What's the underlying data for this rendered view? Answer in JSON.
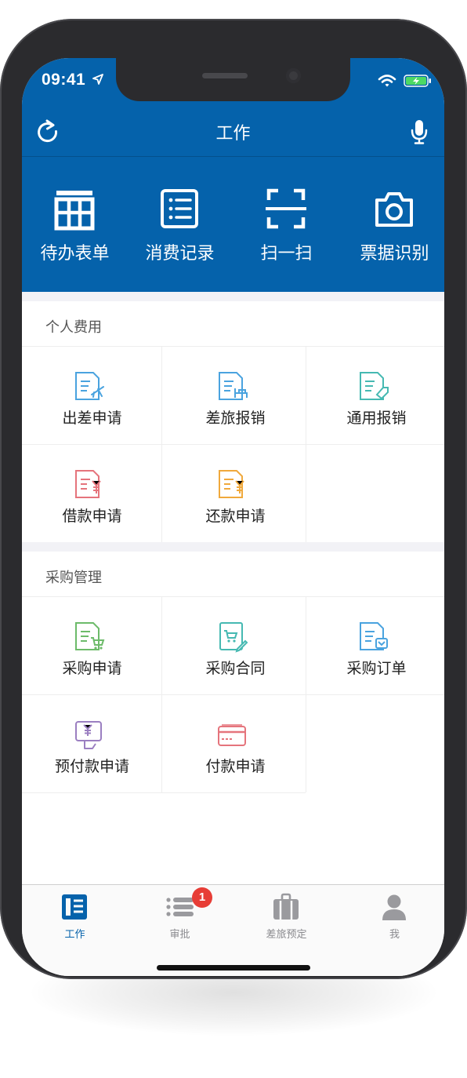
{
  "status_bar": {
    "time": "09:41"
  },
  "navbar": {
    "title": "工作"
  },
  "quick_actions": [
    {
      "label": "待办表单",
      "icon": "form-table-icon"
    },
    {
      "label": "消费记录",
      "icon": "list-record-icon"
    },
    {
      "label": "扫一扫",
      "icon": "scan-icon"
    },
    {
      "label": "票据识别",
      "icon": "camera-icon"
    }
  ],
  "personal": {
    "title": "个人费用",
    "items": [
      {
        "label": "出差申请",
        "icon": "doc-plane-icon",
        "color": "#4aa3df"
      },
      {
        "label": "差旅报销",
        "icon": "doc-bed-icon",
        "color": "#4aa3df"
      },
      {
        "label": "通用报销",
        "icon": "doc-tag-icon",
        "color": "#46b9b2"
      },
      {
        "label": "借款申请",
        "icon": "doc-yen-icon",
        "color": "#e5747c"
      },
      {
        "label": "还款申请",
        "icon": "doc-yen-return-icon",
        "color": "#f0a93c"
      }
    ]
  },
  "purchase": {
    "title": "采购管理",
    "items": [
      {
        "label": "采购申请",
        "icon": "doc-cart-icon",
        "color": "#6dbb6a"
      },
      {
        "label": "采购合同",
        "icon": "doc-cart-pen-icon",
        "color": "#46b9b2"
      },
      {
        "label": "采购订单",
        "icon": "doc-order-icon",
        "color": "#4aa3df"
      },
      {
        "label": "预付款申请",
        "icon": "doc-yen-hand-icon",
        "color": "#9b7fc1"
      },
      {
        "label": "付款申请",
        "icon": "card-icon",
        "color": "#e5747c"
      }
    ]
  },
  "tabbar": {
    "tabs": [
      {
        "label": "工作",
        "icon": "work-icon",
        "active": true
      },
      {
        "label": "审批",
        "icon": "approval-list-icon",
        "badge": "1"
      },
      {
        "label": "差旅预定",
        "icon": "briefcase-icon"
      },
      {
        "label": "我",
        "icon": "person-icon"
      }
    ]
  },
  "colors": {
    "brand_blue": "#0562ab",
    "badge_red": "#e73d36"
  }
}
